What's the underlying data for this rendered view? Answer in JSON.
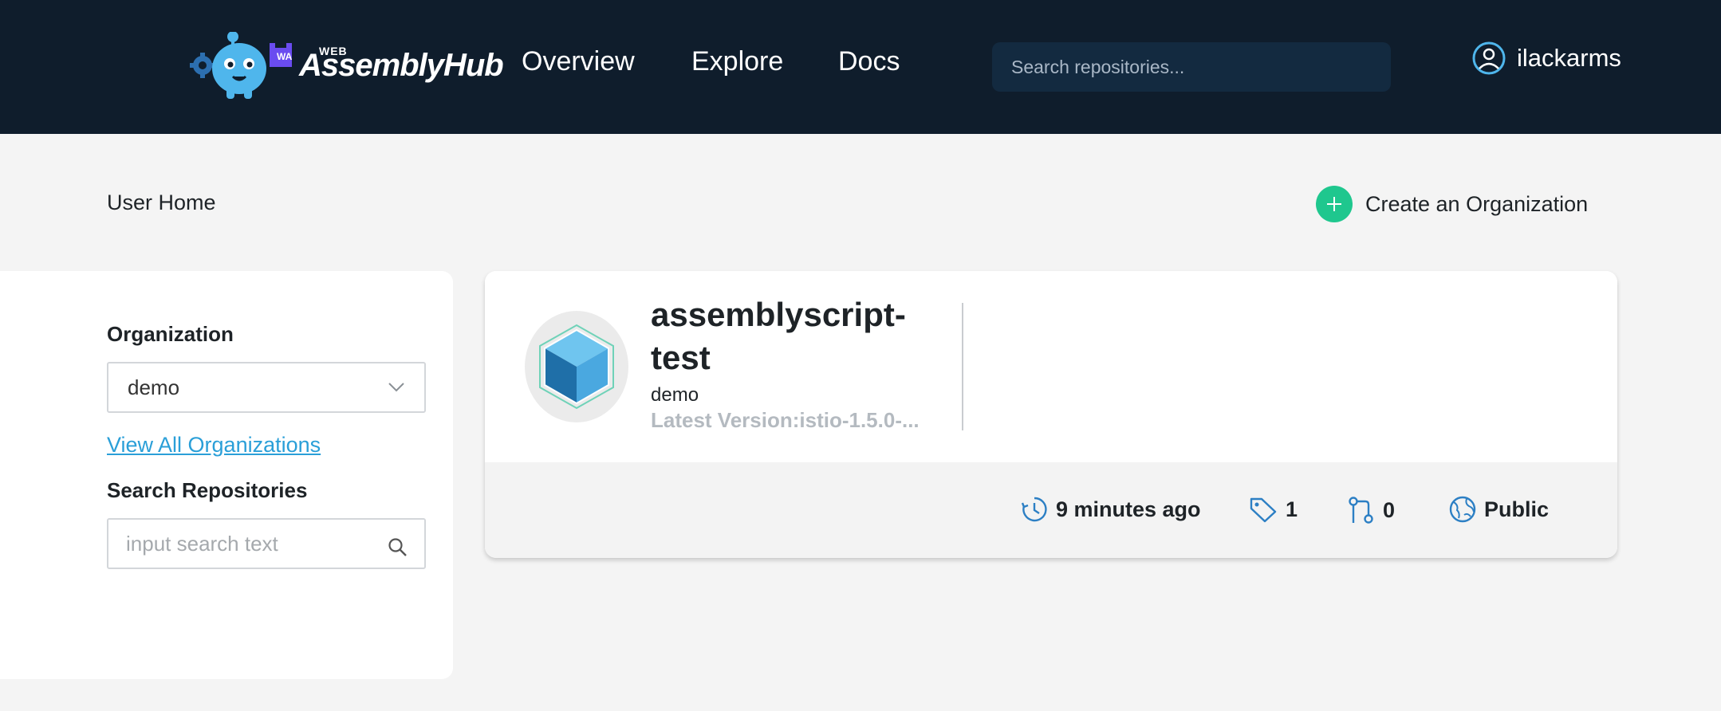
{
  "header": {
    "logo_small": "WEB",
    "logo_word": "AssemblyHub",
    "logo_badge": "WA",
    "nav": [
      "Overview",
      "Explore",
      "Docs"
    ],
    "search_placeholder": "Search repositories...",
    "username": "ilackarms"
  },
  "page": {
    "title": "User Home",
    "create_org_label": "Create an Organization"
  },
  "sidebar": {
    "org_label": "Organization",
    "org_selected": "demo",
    "view_all_label": "View All Organizations",
    "search_label": "Search Repositories",
    "search_placeholder": "input search text"
  },
  "repo": {
    "name": "assemblyscript-test",
    "owner": "demo",
    "latest_version": "Latest Version:istio-1.5.0-...",
    "updated": "9 minutes ago",
    "tags": "1",
    "pulls": "0",
    "visibility": "Public"
  },
  "colors": {
    "header_bg": "#0f1d2c",
    "accent_green": "#1fc78e",
    "link_blue": "#2a9fd8",
    "icon_blue": "#2c7fc4"
  },
  "icons": [
    "settings-gear-icon",
    "mascot-icon",
    "user-icon",
    "plus-icon",
    "chevron-down-icon",
    "search-icon",
    "cube-icon",
    "clock-icon",
    "tag-icon",
    "pull-request-icon",
    "globe-icon"
  ]
}
